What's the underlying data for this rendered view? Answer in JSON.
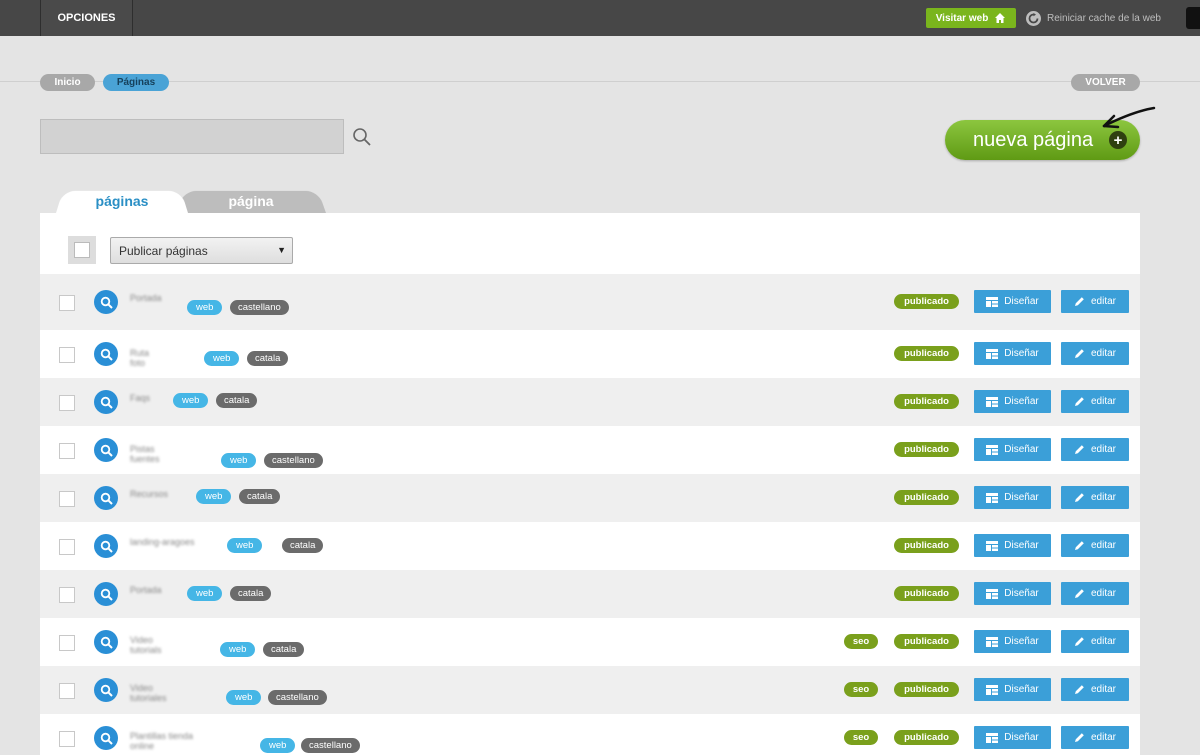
{
  "topbar": {
    "opciones": "OPCIONES",
    "visit_web": "Visitar web",
    "reset_cache": "Reiniciar cache de la web"
  },
  "breadcrumb": {
    "inicio": "Inicio",
    "paginas": "Páginas"
  },
  "volver": "VOLVER",
  "search": {
    "value": "",
    "placeholder": ""
  },
  "new_page": "nueva página",
  "tabs": {
    "active": "páginas",
    "inactive": "página"
  },
  "bulk_action": "Publicar páginas",
  "rows": [
    {
      "name": "Portada",
      "type": "web",
      "lang": "castellano",
      "seo": "",
      "status": "publicado"
    },
    {
      "name": "Ruta\nfoto",
      "type": "web",
      "lang": "catala",
      "seo": "",
      "status": "publicado"
    },
    {
      "name": "Faqs",
      "type": "web",
      "lang": "catala",
      "seo": "",
      "status": "publicado"
    },
    {
      "name": "Pistas\nfuentes",
      "type": "web",
      "lang": "castellano",
      "seo": "",
      "status": "publicado"
    },
    {
      "name": "Recursos",
      "type": "web",
      "lang": "catala",
      "seo": "",
      "status": "publicado"
    },
    {
      "name": "landing-aragoes",
      "type": "web",
      "lang": "catala",
      "seo": "",
      "status": "publicado"
    },
    {
      "name": "Portada",
      "type": "web",
      "lang": "catala",
      "seo": "",
      "status": "publicado"
    },
    {
      "name": "Video\ntutorials",
      "type": "web",
      "lang": "catala",
      "seo": "seo",
      "status": "publicado"
    },
    {
      "name": "Video\ntutoriales",
      "type": "web",
      "lang": "castellano",
      "seo": "seo",
      "status": "publicado"
    },
    {
      "name": "Plantillas tienda\nonline",
      "type": "web",
      "lang": "castellano",
      "seo": "seo",
      "status": "publicado"
    }
  ],
  "row_actions": {
    "design": "Diseñar",
    "edit": "editar"
  },
  "colors": {
    "accent_green": "#7ab51d",
    "accent_blue": "#3b9fd8",
    "status_green": "#7aa01c"
  }
}
